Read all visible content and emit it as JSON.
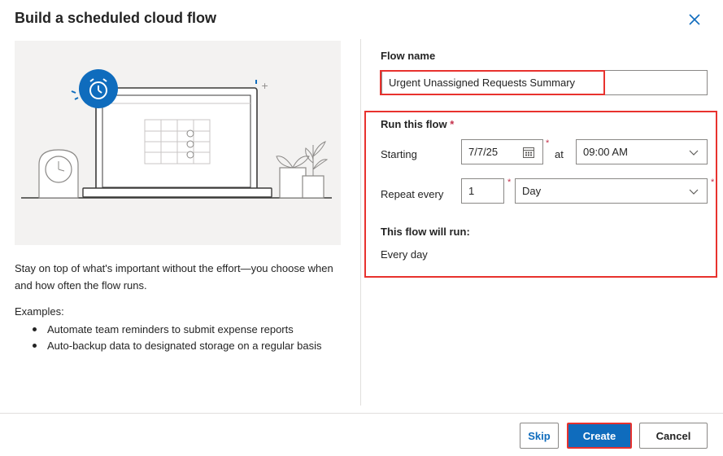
{
  "dialog": {
    "title": "Build a scheduled cloud flow",
    "description": "Stay on top of what's important without the effort—you choose when and how often the flow runs.",
    "examples_title": "Examples:",
    "examples": [
      "Automate team reminders to submit expense reports",
      "Auto-backup data to designated storage on a regular basis"
    ]
  },
  "form": {
    "flow_name_label": "Flow name",
    "flow_name_value": "Urgent Unassigned Requests Summary",
    "run_label": "Run this flow",
    "required_mark": "*",
    "starting_label": "Starting",
    "start_date": "7/7/25",
    "at_label": "at",
    "start_time": "09:00 AM",
    "repeat_label": "Repeat every",
    "repeat_interval": "1",
    "repeat_unit": "Day",
    "will_run_label": "This flow will run:",
    "will_run_value": "Every day"
  },
  "footer": {
    "skip": "Skip",
    "create": "Create",
    "cancel": "Cancel"
  },
  "colors": {
    "accent": "#0f6cbd",
    "highlight_red": "#e8322e",
    "required_red": "#c4314b"
  }
}
